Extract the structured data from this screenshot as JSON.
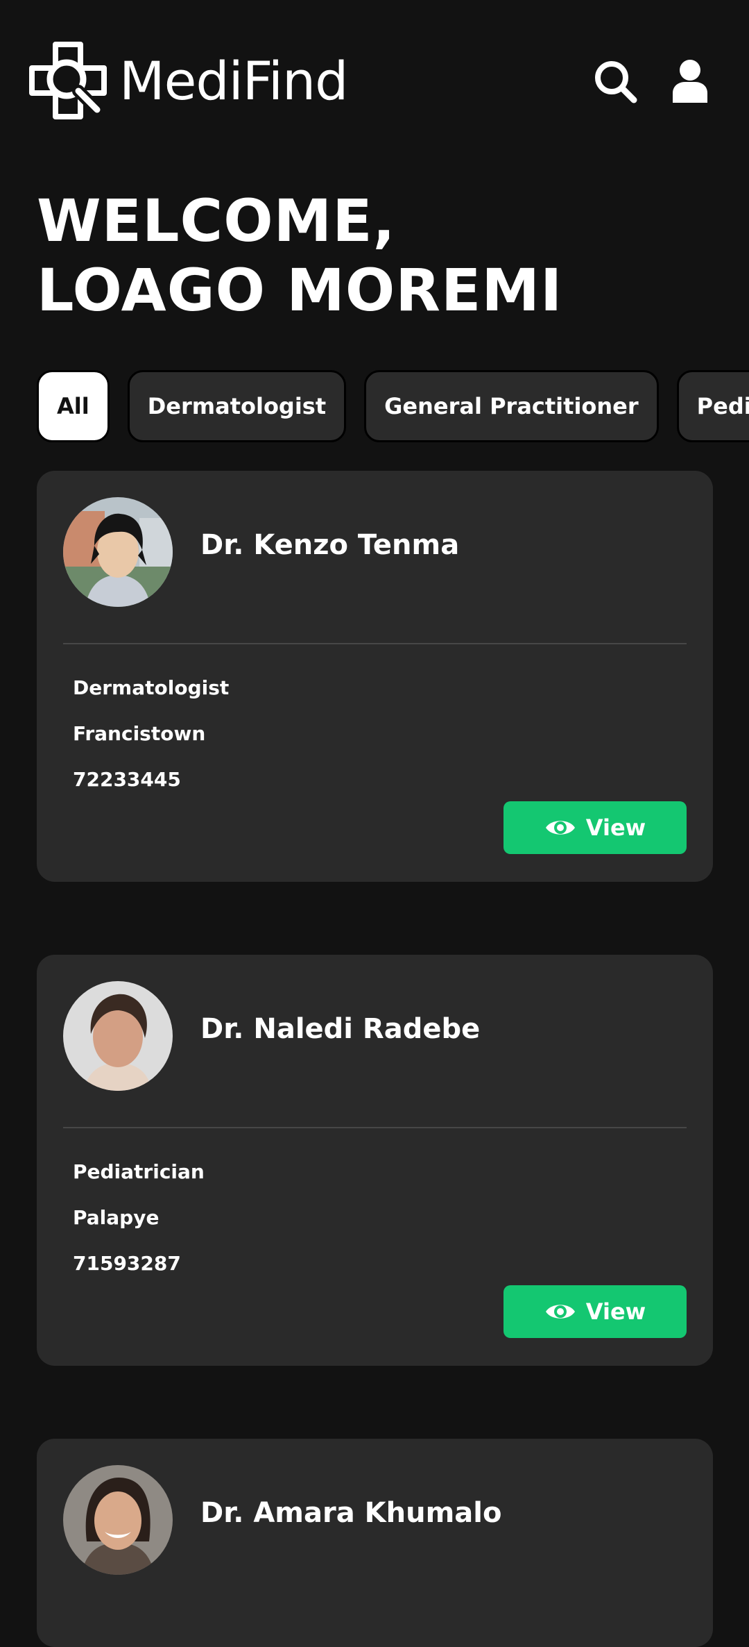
{
  "app": {
    "name": "MediFind"
  },
  "header": {
    "icons": [
      "search-icon",
      "user-icon"
    ]
  },
  "welcome": {
    "line1": "WELCOME,",
    "line2": "LOAGO MOREMI"
  },
  "filters": [
    {
      "label": "All",
      "active": true
    },
    {
      "label": "Dermatologist",
      "active": false
    },
    {
      "label": "General Practitioner",
      "active": false
    },
    {
      "label": "Pediatrician",
      "active": false
    }
  ],
  "doctors": [
    {
      "name": "Dr. Kenzo Tenma",
      "specialty": "Dermatologist",
      "location": "Francistown",
      "phone": "72233445",
      "button": "View"
    },
    {
      "name": "Dr. Naledi Radebe",
      "specialty": "Pediatrician",
      "location": "Palapye",
      "phone": "71593287",
      "button": "View"
    },
    {
      "name": "Dr. Amara Khumalo"
    }
  ],
  "colors": {
    "background": "#121212",
    "card": "#2a2a2a",
    "accent": "#14c771"
  }
}
